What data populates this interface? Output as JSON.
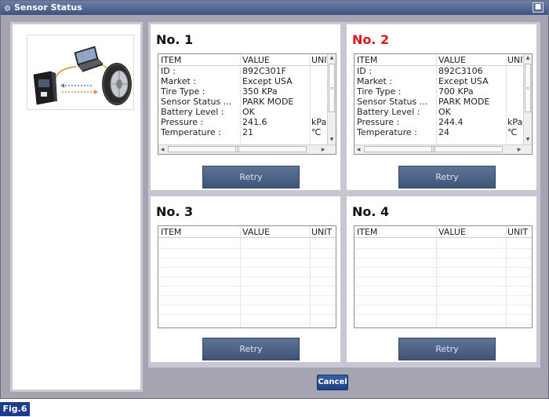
{
  "window": {
    "title": "Sensor Status",
    "close_icon": "close-icon"
  },
  "slots": [
    {
      "title": "No. 1",
      "title_color": "#111111",
      "columns": [
        "ITEM",
        "VALUE",
        "UNIT"
      ],
      "rows": [
        [
          "ID :",
          "892C301F",
          ""
        ],
        [
          "Market :",
          "Except USA",
          ""
        ],
        [
          "Tire Type :",
          "350 KPa",
          ""
        ],
        [
          "Sensor Status ...",
          "PARK MODE",
          ""
        ],
        [
          "Battery Level :",
          "OK",
          ""
        ],
        [
          "Pressure :",
          "241.6",
          "kPa"
        ],
        [
          "Temperature :",
          "21",
          "℃"
        ]
      ],
      "retry_label": "Retry"
    },
    {
      "title": "No. 2",
      "title_color": "#e01818",
      "columns": [
        "ITEM",
        "VALUE",
        "UNIT"
      ],
      "rows": [
        [
          "ID :",
          "892C3106",
          ""
        ],
        [
          "Market :",
          "Except USA",
          ""
        ],
        [
          "Tire Type :",
          "700 KPa",
          ""
        ],
        [
          "Sensor Status ...",
          "PARK MODE",
          ""
        ],
        [
          "Battery Level :",
          "OK",
          ""
        ],
        [
          "Pressure :",
          "244.4",
          "kPa"
        ],
        [
          "Temperature :",
          "24",
          "℃"
        ]
      ],
      "retry_label": "Retry"
    },
    {
      "title": "No. 3",
      "title_color": "#111111",
      "columns": [
        "ITEM",
        "VALUE",
        "UNIT"
      ],
      "rows": [],
      "retry_label": "Retry"
    },
    {
      "title": "No. 4",
      "title_color": "#111111",
      "columns": [
        "ITEM",
        "VALUE",
        "UNIT"
      ],
      "rows": [],
      "retry_label": "Retry"
    }
  ],
  "cancel_label": "Cancel",
  "figure_label": "Fig.6",
  "colors": {
    "accent": "#1f3b8e",
    "button": "#4a6084",
    "alert": "#e01818"
  }
}
